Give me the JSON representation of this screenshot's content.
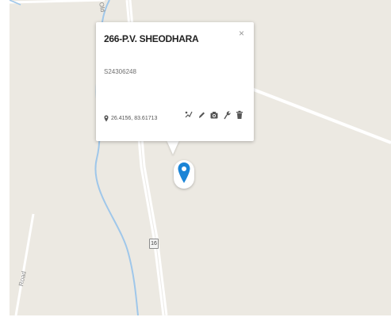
{
  "map": {
    "road_label_top": "Old",
    "road_label_left": "Road",
    "route_shield": "16",
    "colors": {
      "land": "#ece9e2",
      "river": "#9fc7ea",
      "road": "#ffffff",
      "marker": "#1a84d6"
    }
  },
  "popup": {
    "title": "266-P.V. SHEODHARA",
    "close_label": "×",
    "identifier": "S24306248",
    "coordinates": "26.4156, 83.61713",
    "icons": {
      "location": "location-pin-icon",
      "satellite": "satellite-icon",
      "edit": "pencil-icon",
      "photo": "camera-icon",
      "tool": "wrench-icon",
      "delete": "trash-icon"
    }
  },
  "marker": {
    "icon": "location-pin-icon"
  }
}
